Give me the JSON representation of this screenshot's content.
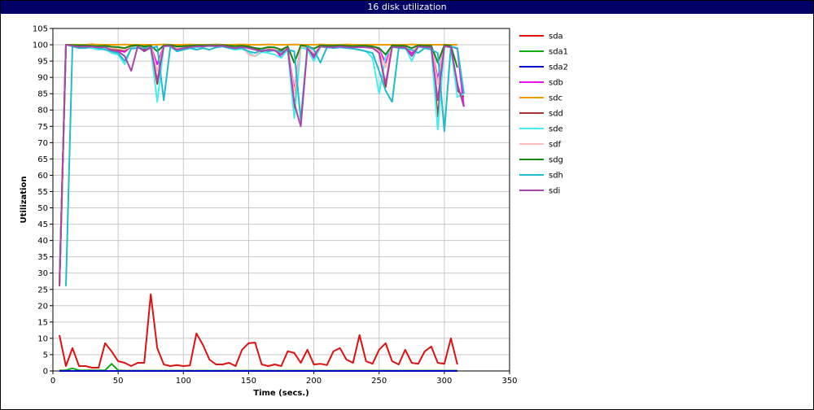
{
  "window": {
    "title": "16 disk utilization"
  },
  "chart_data": {
    "type": "line",
    "title": "16 disk utilization",
    "xlabel": "Time (secs.)",
    "ylabel": "Utilization",
    "xlim": [
      0,
      350
    ],
    "ylim": [
      0,
      105
    ],
    "xticks": [
      0,
      50,
      100,
      150,
      200,
      250,
      300,
      350
    ],
    "yticks": [
      0,
      5,
      10,
      15,
      20,
      25,
      30,
      35,
      40,
      45,
      50,
      55,
      60,
      65,
      70,
      75,
      80,
      85,
      90,
      95,
      100,
      105
    ],
    "grid": true,
    "legend_position": "right",
    "series": [
      {
        "name": "sda",
        "color": "#dd1111",
        "x": [
          5,
          10,
          15,
          20,
          25,
          30,
          35,
          40,
          45,
          50,
          55,
          60,
          65,
          70,
          75,
          80,
          85,
          90,
          95,
          100,
          105,
          110,
          115,
          120,
          125,
          130,
          135,
          140,
          145,
          150,
          155,
          160,
          165,
          170,
          175,
          180,
          185,
          190,
          195,
          200,
          205,
          210,
          215,
          220,
          225,
          230,
          235,
          240,
          245,
          250,
          255,
          260,
          265,
          270,
          275,
          280,
          285,
          290,
          295,
          300,
          305,
          310
        ],
        "y": [
          11,
          1.5,
          7,
          1.5,
          1.5,
          1,
          1,
          8.5,
          6,
          3,
          2.5,
          1.5,
          2.5,
          2.5,
          23.5,
          7,
          2,
          1.5,
          1.8,
          1.5,
          1.7,
          11.5,
          8,
          3.5,
          2,
          2,
          2.5,
          1.5,
          6.5,
          8.5,
          8.7,
          2,
          1.5,
          2,
          1.5,
          6,
          5.5,
          2.5,
          6.5,
          2,
          2.2,
          1.8,
          6,
          7,
          3.5,
          2.5,
          11,
          3,
          2.2,
          6.5,
          8.5,
          3,
          2,
          6.5,
          2.5,
          2.2,
          6,
          7.5,
          2.5,
          2.2,
          10,
          2
        ]
      },
      {
        "name": "sda1",
        "color": "#11aa11",
        "x": [
          5,
          10,
          15,
          20,
          25,
          30,
          35,
          40,
          45,
          50,
          55,
          100,
          150,
          200,
          250,
          300,
          310
        ],
        "y": [
          0.2,
          0.2,
          0.8,
          0.2,
          0.2,
          0.2,
          0.2,
          0.2,
          2.2,
          0.2,
          0.1,
          0.1,
          0.1,
          0.1,
          0.1,
          0.1,
          0.1
        ]
      },
      {
        "name": "sda2",
        "color": "#0000cc",
        "x": [
          5,
          310
        ],
        "y": [
          0,
          0
        ]
      },
      {
        "name": "sdb",
        "color": "#ee11ee",
        "x": [
          5,
          10,
          15,
          20,
          25,
          30,
          35,
          40,
          45,
          50,
          55,
          60,
          65,
          70,
          75,
          80,
          85,
          90,
          95,
          100,
          105,
          110,
          115,
          120,
          125,
          130,
          135,
          140,
          145,
          150,
          155,
          160,
          165,
          170,
          175,
          180,
          185,
          190,
          195,
          200,
          205,
          210,
          215,
          220,
          225,
          230,
          235,
          240,
          245,
          250,
          255,
          260,
          265,
          270,
          275,
          280,
          285,
          290,
          295,
          300,
          305,
          310,
          315
        ],
        "y": [
          26,
          100,
          99.8,
          99.5,
          99.8,
          99.7,
          99.5,
          99.4,
          98.5,
          98.3,
          97.8,
          99.5,
          99.7,
          99.3,
          99.5,
          94,
          99.7,
          99.8,
          98.8,
          99.2,
          99.5,
          99.7,
          99.6,
          99.8,
          100,
          99.8,
          99.5,
          99.4,
          99.6,
          99.5,
          99,
          98.6,
          99.2,
          99,
          96,
          99.2,
          86,
          99.8,
          99.5,
          96,
          99.7,
          99.5,
          99.5,
          99.6,
          99.5,
          99.4,
          99.5,
          99.6,
          99.2,
          98.5,
          94.5,
          99.8,
          99.5,
          99.6,
          97.3,
          99.7,
          99.5,
          99.6,
          89.5,
          99.8,
          99.5,
          98.8,
          81
        ]
      },
      {
        "name": "sdc",
        "color": "#ee9900",
        "x": [
          5,
          10,
          15,
          20,
          25,
          30,
          35,
          40,
          45,
          50,
          55,
          60,
          65,
          70,
          75,
          80,
          85,
          90,
          95,
          100,
          105,
          110,
          115,
          120,
          125,
          130,
          135,
          140,
          145,
          150,
          155,
          160,
          165,
          170,
          175,
          180,
          185,
          190,
          195,
          200,
          205,
          210,
          215,
          220,
          225,
          230,
          235,
          240,
          245,
          250,
          255,
          260,
          265,
          270,
          275,
          280,
          285,
          290,
          295,
          300,
          305,
          310
        ],
        "y": [
          26,
          100,
          100,
          100,
          100,
          100.2,
          100,
          100,
          100,
          100,
          100.1,
          100,
          100,
          100,
          100,
          100,
          100.1,
          100,
          100,
          100,
          100.1,
          100,
          100,
          100,
          100.1,
          100,
          100,
          100,
          100.1,
          100,
          100,
          100,
          100.1,
          100,
          100,
          100,
          100.1,
          100,
          100,
          100,
          100.1,
          100,
          100,
          100,
          100.1,
          100,
          100,
          100,
          100,
          100,
          100,
          100,
          100,
          100,
          100.1,
          100,
          100,
          100,
          100,
          100,
          100,
          100
        ]
      },
      {
        "name": "sdd",
        "color": "#aa3333",
        "x": [
          5,
          10,
          15,
          20,
          25,
          30,
          35,
          40,
          45,
          50,
          55,
          60,
          65,
          70,
          75,
          80,
          85,
          90,
          95,
          100,
          105,
          110,
          115,
          120,
          125,
          130,
          135,
          140,
          145,
          150,
          155,
          160,
          165,
          170,
          175,
          180,
          185,
          190,
          195,
          200,
          205,
          210,
          215,
          220,
          225,
          230,
          235,
          240,
          245,
          250,
          255,
          260,
          265,
          270,
          275,
          280,
          285,
          290,
          295,
          300,
          305,
          310,
          315
        ],
        "y": [
          26,
          100,
          99.7,
          99.5,
          99.6,
          99.5,
          99.3,
          99.4,
          98.8,
          98.5,
          98.3,
          99.5,
          99.6,
          98.5,
          99.5,
          88,
          99.6,
          99.8,
          98.8,
          99.2,
          99.4,
          99.5,
          99.6,
          99.8,
          99.7,
          99.8,
          99.5,
          99.4,
          99.5,
          99.4,
          98.8,
          98.3,
          98.8,
          98.5,
          98,
          99,
          79,
          99.5,
          99.2,
          97,
          99.6,
          99.4,
          99.5,
          99.6,
          99.5,
          99.3,
          99.4,
          99.5,
          99.2,
          98,
          87,
          99.5,
          99.4,
          99.5,
          98,
          99.6,
          99.4,
          99.5,
          78,
          99.7,
          99.4,
          86,
          84
        ]
      },
      {
        "name": "sde",
        "color": "#44eeee",
        "x": [
          5,
          10,
          15,
          20,
          25,
          30,
          35,
          40,
          45,
          50,
          55,
          60,
          65,
          70,
          75,
          80,
          85,
          90,
          95,
          100,
          105,
          110,
          115,
          120,
          125,
          130,
          135,
          140,
          145,
          150,
          155,
          160,
          165,
          170,
          175,
          180,
          185,
          190,
          195,
          200,
          205,
          210,
          215,
          220,
          225,
          230,
          235,
          240,
          245,
          250,
          255,
          260,
          265,
          270,
          275,
          280,
          285,
          290,
          295,
          300,
          305,
          310,
          315
        ],
        "y": [
          26,
          100,
          99.5,
          99,
          99.2,
          99,
          98.5,
          98.8,
          97.5,
          97,
          94,
          99,
          99.3,
          98,
          99,
          82.5,
          99.5,
          99.6,
          98.2,
          98.8,
          99,
          99.2,
          99.4,
          99.6,
          99.5,
          99.6,
          99,
          98.5,
          98.8,
          97.5,
          96.5,
          97.8,
          97.5,
          97,
          96,
          98.5,
          77.5,
          99.3,
          98.5,
          95,
          99.4,
          99.2,
          99.2,
          99.4,
          99.2,
          98.8,
          98.5,
          98,
          96,
          85,
          96.5,
          99.3,
          99,
          99.2,
          95,
          99.4,
          99,
          98.8,
          74,
          99.5,
          99.2,
          84,
          85
        ]
      },
      {
        "name": "sdf",
        "color": "#ffbbbb",
        "x": [
          5,
          10,
          15,
          20,
          25,
          30,
          35,
          40,
          45,
          50,
          55,
          60,
          65,
          70,
          75,
          80,
          85,
          90,
          95,
          100,
          105,
          110,
          115,
          120,
          125,
          130,
          135,
          140,
          145,
          150,
          155,
          160,
          165,
          170,
          175,
          180,
          185,
          190,
          195,
          200,
          205,
          210,
          215,
          220,
          225,
          230,
          235,
          240,
          245,
          250,
          255,
          260,
          265,
          270,
          275,
          280,
          285,
          290,
          295,
          300,
          305,
          310
        ],
        "y": [
          26,
          100,
          99.8,
          99.6,
          99.7,
          99.6,
          99.4,
          99.5,
          99,
          98.8,
          98.5,
          99.6,
          99.7,
          99,
          99.6,
          92,
          99.7,
          99.8,
          99,
          99.3,
          99.5,
          99.6,
          99.7,
          99.8,
          99.7,
          99.8,
          99.6,
          99.5,
          99.6,
          97,
          96.5,
          98.5,
          99,
          98.8,
          97.5,
          99.2,
          85,
          99.6,
          99.3,
          97.5,
          99.7,
          99.5,
          99.6,
          99.7,
          99.6,
          99.4,
          99.5,
          99.6,
          99.3,
          98,
          93,
          99.6,
          99.5,
          99.6,
          98,
          99.7,
          99.5,
          99.6,
          88,
          99.8,
          99.5,
          88
        ]
      },
      {
        "name": "sdg",
        "color": "#118811",
        "x": [
          5,
          10,
          15,
          20,
          25,
          30,
          35,
          40,
          45,
          50,
          55,
          60,
          65,
          70,
          75,
          80,
          85,
          90,
          95,
          100,
          105,
          110,
          115,
          120,
          125,
          130,
          135,
          140,
          145,
          150,
          155,
          160,
          165,
          170,
          175,
          180,
          185,
          190,
          195,
          200,
          205,
          210,
          215,
          220,
          225,
          230,
          235,
          240,
          245,
          250,
          255,
          260,
          265,
          270,
          275,
          280,
          285,
          290,
          295,
          300,
          305,
          310
        ],
        "y": [
          26,
          100,
          99.9,
          99.8,
          99.8,
          99.7,
          99.6,
          99.7,
          99.4,
          99.3,
          99,
          99.7,
          99.8,
          99.5,
          99.7,
          98,
          99.8,
          99.9,
          99.5,
          99.6,
          99.7,
          99.8,
          99.8,
          99.9,
          99.8,
          99.9,
          99.7,
          99.6,
          99.7,
          99.5,
          99,
          98.8,
          99.3,
          99.2,
          98.5,
          99.5,
          94.5,
          99.8,
          99.6,
          98.8,
          99.8,
          99.7,
          99.7,
          99.8,
          99.7,
          99.6,
          99.7,
          99.7,
          99.5,
          99,
          97,
          99.8,
          99.7,
          99.7,
          99,
          99.8,
          99.7,
          99.7,
          94.5,
          99.9,
          99.7,
          93
        ]
      },
      {
        "name": "sdh",
        "color": "#22bbcc",
        "x": [
          10,
          15,
          20,
          25,
          30,
          35,
          40,
          45,
          50,
          55,
          60,
          65,
          70,
          75,
          80,
          85,
          90,
          95,
          100,
          105,
          110,
          115,
          120,
          125,
          130,
          135,
          140,
          145,
          150,
          155,
          160,
          165,
          170,
          175,
          180,
          185,
          190,
          195,
          200,
          205,
          210,
          215,
          220,
          225,
          230,
          235,
          240,
          245,
          250,
          255,
          260,
          265,
          270,
          275,
          280,
          285,
          290,
          295,
          300,
          305,
          310,
          315
        ],
        "y": [
          26,
          99.5,
          99,
          99,
          99.5,
          99,
          98.5,
          98,
          97.5,
          95,
          98.8,
          99,
          99,
          99,
          99.5,
          83,
          99.5,
          98,
          98.5,
          99,
          98.5,
          99,
          98.5,
          99.2,
          99.5,
          99,
          98.8,
          99,
          98,
          97.5,
          98.5,
          98,
          98.3,
          97.8,
          98.5,
          98,
          77,
          99.5,
          98.5,
          94.5,
          99.2,
          99,
          99.2,
          99,
          98.8,
          98.5,
          98,
          97.5,
          92,
          86,
          82.5,
          99,
          98.8,
          98.5,
          97.5,
          99,
          98.5,
          97.5,
          73.5,
          99.5,
          99,
          85
        ]
      },
      {
        "name": "sdi",
        "color": "#aa44aa",
        "x": [
          5,
          10,
          15,
          20,
          25,
          30,
          35,
          40,
          45,
          50,
          55,
          60,
          65,
          70,
          75,
          80,
          85,
          90,
          95,
          100,
          105,
          110,
          115,
          120,
          125,
          130,
          135,
          140,
          145,
          150,
          155,
          160,
          165,
          170,
          175,
          180,
          185,
          190,
          195,
          200,
          205,
          210,
          215,
          220,
          225,
          230,
          235,
          240,
          245,
          250,
          255,
          260,
          265,
          270,
          275,
          280,
          285,
          290,
          295,
          300,
          305,
          310,
          315
        ],
        "y": [
          26,
          100,
          99.7,
          99.4,
          99.5,
          99.4,
          99.2,
          99.3,
          98.3,
          98,
          96.5,
          92,
          99.5,
          98,
          99.3,
          89,
          99.6,
          99.7,
          98.5,
          99,
          99.3,
          99.5,
          99.5,
          99.7,
          99.6,
          99.7,
          99.3,
          99,
          99.3,
          99,
          98.5,
          98,
          98.5,
          98.2,
          97,
          99,
          82,
          75,
          99,
          96.5,
          99.5,
          99.3,
          99.3,
          99.5,
          99.3,
          99.2,
          99.3,
          99.2,
          99,
          97.5,
          88,
          99.4,
          99.2,
          99.3,
          96.5,
          99.5,
          99.3,
          99.2,
          83,
          99.6,
          99.3,
          88,
          81
        ]
      }
    ]
  }
}
